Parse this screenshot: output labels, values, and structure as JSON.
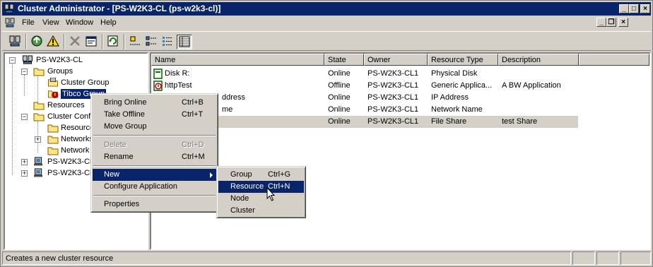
{
  "window": {
    "title": "Cluster Administrator - [PS-W2K3-CL (ps-w2k3-cl)]"
  },
  "menubar": {
    "file": "File",
    "view": "View",
    "window": "Window",
    "help": "Help"
  },
  "tree": {
    "root": "PS-W2K3-CL",
    "groups": "Groups",
    "cluster_group": "Cluster Group",
    "tibco_group": "Tibco Group",
    "resources": "Resources",
    "cluster_config": "Cluster Confi",
    "resource_types": "Resource",
    "networks": "Networks",
    "network_interfaces": "Network",
    "node1": "PS-W2K3-CL",
    "node2": "PS-W2K3-CL2"
  },
  "list": {
    "columns": [
      "Name",
      "State",
      "Owner",
      "Resource Type",
      "Description"
    ],
    "rows": [
      {
        "name": "Disk R:",
        "state": "Online",
        "owner": "PS-W2K3-CL1",
        "type": "Physical Disk",
        "description": ""
      },
      {
        "name": "httpTest",
        "state": "Offline",
        "owner": "PS-W2K3-CL1",
        "type": "Generic Applica...",
        "description": "A BW Application"
      },
      {
        "name": "ddress",
        "state": "Online",
        "owner": "PS-W2K3-CL1",
        "type": "IP Address",
        "description": ""
      },
      {
        "name": "me",
        "state": "Online",
        "owner": "PS-W2K3-CL1",
        "type": "Network Name",
        "description": ""
      },
      {
        "name": "",
        "state": "Online",
        "owner": "PS-W2K3-CL1",
        "type": "File Share",
        "description": "test Share"
      }
    ]
  },
  "context_menu": {
    "bring_online": {
      "label": "Bring Online",
      "accel": "Ctrl+B"
    },
    "take_offline": {
      "label": "Take Offline",
      "accel": "Ctrl+T"
    },
    "move_group": {
      "label": "Move Group"
    },
    "delete": {
      "label": "Delete",
      "accel": "Ctrl+D"
    },
    "rename": {
      "label": "Rename",
      "accel": "Ctrl+M"
    },
    "new": {
      "label": "New"
    },
    "configure_application": {
      "label": "Configure Application"
    },
    "properties": {
      "label": "Properties"
    }
  },
  "submenu": {
    "group": {
      "label": "Group",
      "accel": "Ctrl+G"
    },
    "resource": {
      "label": "Resource",
      "accel": "Ctrl+N"
    },
    "node": {
      "label": "Node"
    },
    "cluster": {
      "label": "Cluster"
    }
  },
  "status": {
    "text": "Creates a new cluster resource"
  },
  "colors": {
    "title_bar": "#0a246a",
    "highlight": "#0a246a",
    "face": "#d4d0c8"
  },
  "icons": [
    "cluster-icon",
    "folder-icon",
    "group-icon",
    "resource-icon",
    "node-icon",
    "mouse-pointer-icon"
  ]
}
